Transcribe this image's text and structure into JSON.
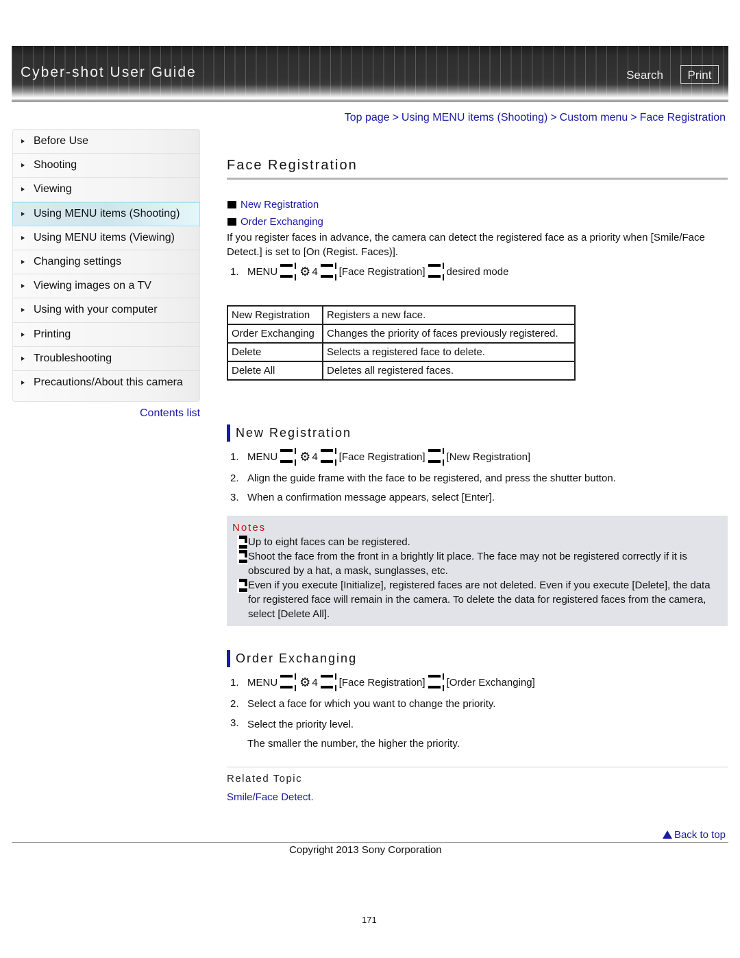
{
  "header": {
    "title": "Cyber-shot User Guide",
    "search_label": "Search",
    "print_label": "Print"
  },
  "breadcrumb": [
    {
      "label": "Top page"
    },
    {
      "label": "Using MENU items (Shooting)"
    },
    {
      "label": "Custom menu"
    },
    {
      "label": "Face Registration"
    }
  ],
  "breadcrumb_separator": ">",
  "sidebar": {
    "items": [
      {
        "label": "Before Use",
        "active": false
      },
      {
        "label": "Shooting",
        "active": false
      },
      {
        "label": "Viewing",
        "active": false
      },
      {
        "label": "Using MENU items (Shooting)",
        "active": true
      },
      {
        "label": "Using MENU items (Viewing)",
        "active": false
      },
      {
        "label": "Changing settings",
        "active": false
      },
      {
        "label": "Viewing images on a TV",
        "active": false
      },
      {
        "label": "Using with your computer",
        "active": false
      },
      {
        "label": "Printing",
        "active": false
      },
      {
        "label": "Troubleshooting",
        "active": false
      },
      {
        "label": "Precautions/About this camera",
        "active": false
      }
    ],
    "contents_list_label": "Contents list"
  },
  "main": {
    "title": "Face Registration",
    "toc": [
      "New Registration",
      "Order Exchanging"
    ],
    "intro": "If you register faces in advance, the camera can detect the registered face as a priority when [Smile/Face Detect.] is set to [On (Regist. Faces)].",
    "intro_step": {
      "num": "1.",
      "menu": "MENU",
      "tab_num": "4",
      "item": "[Face Registration]",
      "target": "desired mode"
    },
    "options_table": [
      {
        "name": "New Registration",
        "desc": "Registers a new face."
      },
      {
        "name": "Order Exchanging",
        "desc": "Changes the priority of faces previously registered."
      },
      {
        "name": "Delete",
        "desc": "Selects a registered face to delete."
      },
      {
        "name": "Delete All",
        "desc": "Deletes all registered faces."
      }
    ],
    "new_registration": {
      "heading": "New Registration",
      "steps": [
        {
          "num": "1.",
          "menu": "MENU",
          "tab_num": "4",
          "item": "[Face Registration]",
          "target": "[New Registration]"
        },
        {
          "num": "2.",
          "text": "Align the guide frame with the face to be registered, and press the shutter button."
        },
        {
          "num": "3.",
          "text": "When a confirmation message appears, select [Enter]."
        }
      ]
    },
    "notes": {
      "heading": "Notes",
      "items": [
        "Up to eight faces can be registered.",
        "Shoot the face from the front in a brightly lit place. The face may not be registered correctly if it is obscured by a hat, a mask, sunglasses, etc.",
        "Even if you execute [Initialize], registered faces are not deleted. Even if you execute [Delete], the data for registered face will remain in the camera. To delete the data for registered faces from the camera, select [Delete All]."
      ]
    },
    "order_exchanging": {
      "heading": "Order Exchanging",
      "steps": [
        {
          "num": "1.",
          "menu": "MENU",
          "tab_num": "4",
          "item": "[Face Registration]",
          "target": "[Order Exchanging]"
        },
        {
          "num": "2.",
          "text": "Select a face for which you want to change the priority."
        },
        {
          "num": "3.",
          "text": "Select the priority level.",
          "subtext": "The smaller the number, the higher the priority."
        }
      ]
    },
    "related": {
      "heading": "Related Topic",
      "links": [
        "Smile/Face Detect."
      ]
    }
  },
  "footer": {
    "back_to_top": "Back to top",
    "copyright": "Copyright 2013 Sony Corporation",
    "page_number": "171"
  },
  "icons": {
    "menu_arrow": "bracket-arrow-icon",
    "settings": "⚙",
    "sidebar_arrow": "triangle-right-icon"
  }
}
